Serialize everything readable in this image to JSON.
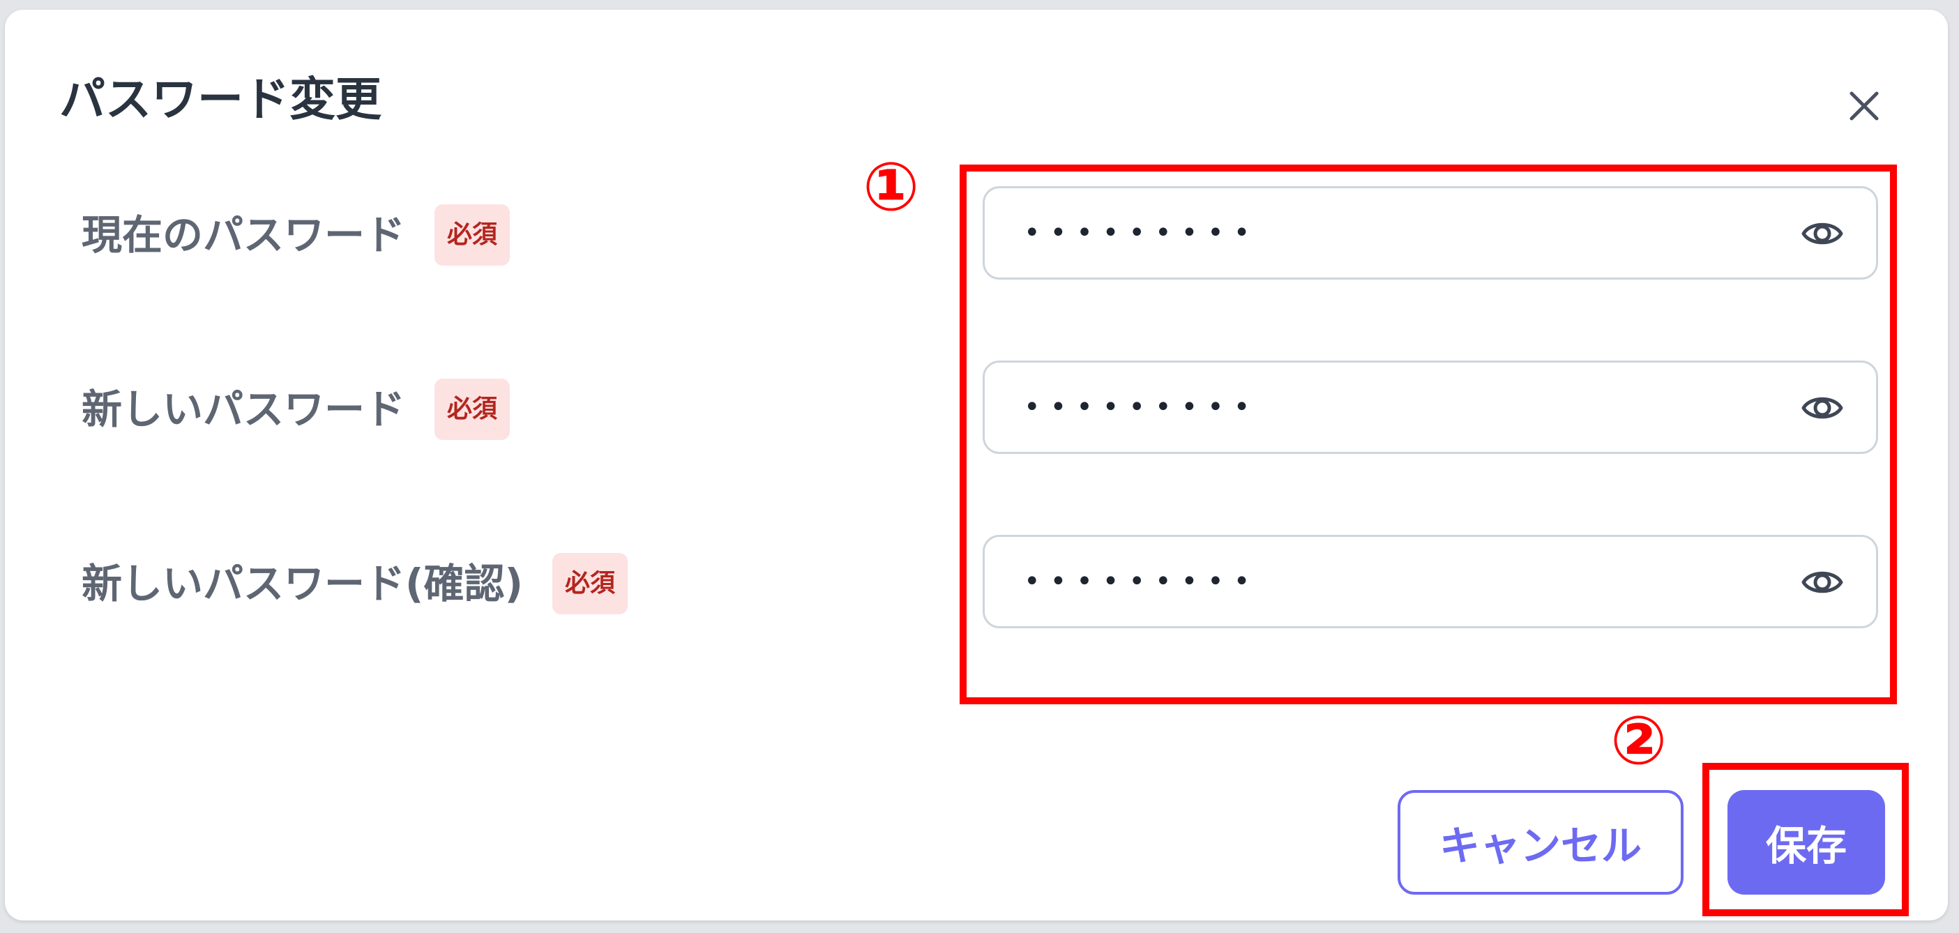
{
  "dialog": {
    "title": "パスワード変更",
    "close_icon": "close-icon"
  },
  "fields": [
    {
      "label": "現在のパスワード",
      "required_badge": "必須",
      "value": "•••••••••",
      "icon": "eye-icon"
    },
    {
      "label": "新しいパスワード",
      "required_badge": "必須",
      "value": "•••••••••",
      "icon": "eye-icon"
    },
    {
      "label": "新しいパスワード(確認)",
      "required_badge": "必須",
      "value": "•••••••••",
      "icon": "eye-icon"
    }
  ],
  "buttons": {
    "cancel": "キャンセル",
    "save": "保存"
  },
  "annotations": {
    "marker1": "①",
    "marker2": "②"
  },
  "colors": {
    "accent": "#6d6af2",
    "annotation": "#ff0000",
    "required_bg": "#fde2e2",
    "required_text": "#b3261e"
  }
}
